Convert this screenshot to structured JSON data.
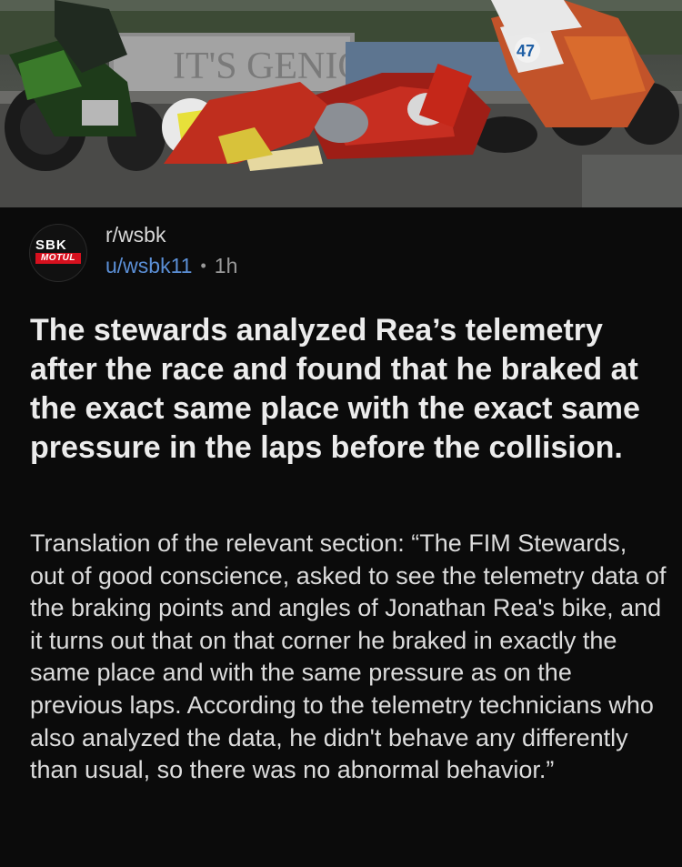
{
  "hero": {
    "banner_text": "IT'S GENIO",
    "bike_number": "47"
  },
  "post": {
    "avatar": {
      "sbk_text": "SBK",
      "motul_text": "MOTUL"
    },
    "subreddit": "r/wsbk",
    "username": "u/wsbk11",
    "separator": "•",
    "age": "1h",
    "title": "The stewards analyzed Rea’s telemetry after the race and found that he braked at the exact same place with the exact same pressure in the laps before the collision.",
    "body": "Translation of the relevant section: “The FIM Stewards, out of good conscience, asked to see the telemetry data of the braking points and angles of Jonathan Rea's bike, and it turns out that on that corner he braked in exactly the same place and with the same pressure as on the previous laps. According to the telemetry technicians who also analyzed the data, he didn't behave any differently than usual, so there was no abnormal behavior.”"
  }
}
